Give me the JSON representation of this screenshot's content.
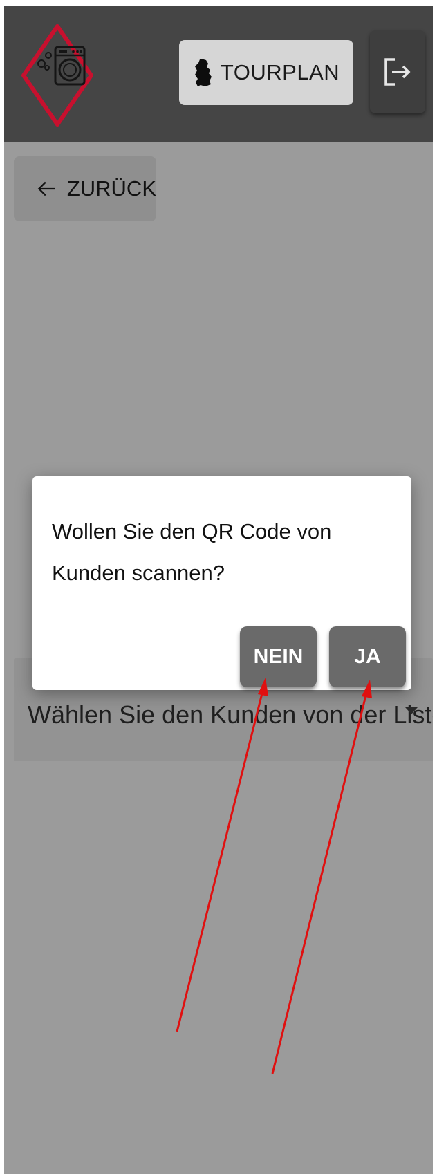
{
  "header": {
    "logo_icon": "washing-machine-logo",
    "tourplan_label": "TOURPLAN",
    "tourplan_icon": "germany-map-icon",
    "logout_icon": "logout-icon"
  },
  "back_button": {
    "label": "ZURÜCK",
    "icon": "arrow-left-icon"
  },
  "customer_select": {
    "text": "Wählen Sie den Kunden von der Liste"
  },
  "dialog": {
    "message": "Wollen Sie den QR Code von Kunden scannen?",
    "buttons": {
      "no": "NEIN",
      "yes": "JA"
    }
  },
  "annotations": {
    "arrow_color": "#e01010",
    "count": 2
  },
  "colors": {
    "appbar": "#454545",
    "background_overlay": "#9b9b9b",
    "button_dark": "#6a6a6a",
    "logo_accent": "#c8102e"
  }
}
